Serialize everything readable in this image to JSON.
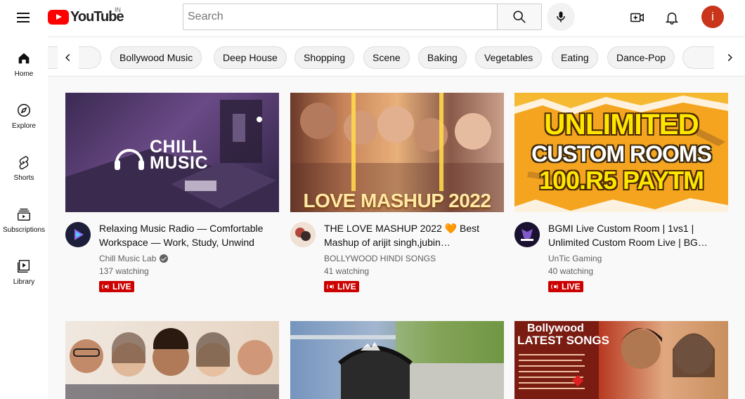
{
  "header": {
    "logo_text": "YouTube",
    "region": "IN",
    "search_placeholder": "Search",
    "avatar_letter": "i"
  },
  "sidebar": {
    "items": [
      {
        "label": "Home"
      },
      {
        "label": "Explore"
      },
      {
        "label": "Shorts"
      },
      {
        "label": "Subscriptions"
      },
      {
        "label": "Library"
      }
    ]
  },
  "chips": [
    {
      "label": "Bollywood Music"
    },
    {
      "label": "Deep House"
    },
    {
      "label": "Shopping"
    },
    {
      "label": "Scene"
    },
    {
      "label": "Baking"
    },
    {
      "label": "Vegetables"
    },
    {
      "label": "Eating"
    },
    {
      "label": "Dance-Pop"
    }
  ],
  "videos": [
    {
      "thumb_text": "CHILL MUSIC",
      "title": "Relaxing Music Radio — Comfortable Workspace — Work, Study, Unwind",
      "channel": "Chill Music Lab",
      "watching": "137 watching",
      "badge": "LIVE"
    },
    {
      "thumb_text": "LOVE MASHUP 2022",
      "title": "THE LOVE MASHUP 2022 🧡 Best Mashup of arijit singh,jubin…",
      "channel": "BOLLYWOOD HINDI SONGS",
      "watching": "41 watching",
      "badge": "LIVE"
    },
    {
      "thumb_text_1": "UNLIMITED",
      "thumb_text_2": "CUSTOM ROOMS",
      "thumb_text_3": "100.R5 PAYTM",
      "title": "BGMI Live Custom Room | 1vs1 | Unlimited Custom Room Live | BG…",
      "channel": "UnTic Gaming",
      "watching": "40 watching",
      "badge": "LIVE"
    },
    {},
    {},
    {
      "thumb_text_1": "Bollywood",
      "thumb_text_2": "LATEST SONGS"
    }
  ],
  "colors": {
    "brand_red": "#ff0000",
    "live_red": "#cc0000",
    "avatar_bg": "#c9341b"
  }
}
